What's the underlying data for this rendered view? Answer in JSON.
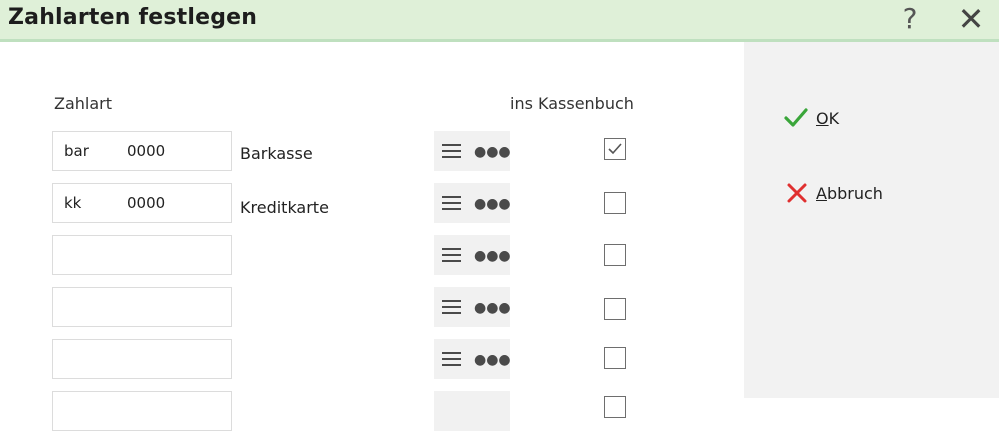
{
  "window": {
    "title": "Zahlarten festlegen",
    "help_glyph": "?",
    "close_glyph": "✕"
  },
  "table": {
    "col_zahlart": "Zahlart",
    "col_kassenbuch": "ins Kassenbuch",
    "rows": [
      {
        "code": "bar",
        "number": "0000",
        "description": "Barkasse",
        "checked": true
      },
      {
        "code": "kk",
        "number": "0000",
        "description": "Kreditkarte",
        "checked": false
      },
      {
        "code": "",
        "number": "",
        "description": "",
        "checked": false
      },
      {
        "code": "",
        "number": "",
        "description": "",
        "checked": false
      },
      {
        "code": "",
        "number": "",
        "description": "",
        "checked": false
      },
      {
        "code": "",
        "number": "",
        "description": "",
        "checked": false
      }
    ]
  },
  "actions": {
    "ok_underline": "O",
    "ok_rest": "K",
    "cancel_underline": "A",
    "cancel_rest": "bbruch"
  },
  "icons": {
    "ok": "check-icon",
    "cancel": "x-icon",
    "list": "list-icon",
    "more": "more-dots-icon"
  },
  "colors": {
    "title_bar": "#dff0d8",
    "check_green": "#3aa63a",
    "cancel_red": "#e03030"
  }
}
